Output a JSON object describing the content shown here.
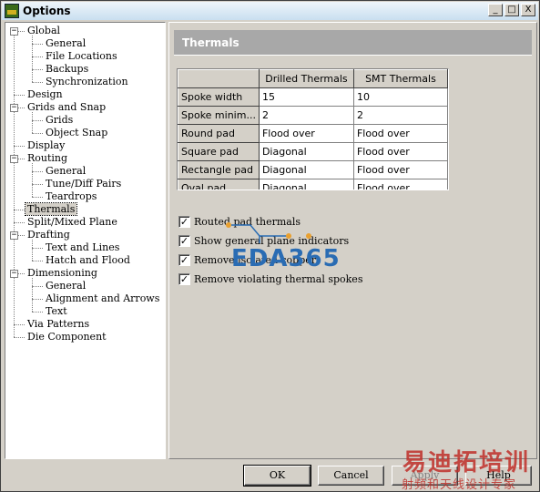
{
  "window": {
    "title": "Options",
    "min_label": "_",
    "max_label": "□",
    "close_label": "X"
  },
  "tree": [
    {
      "label": "Global",
      "level": 0,
      "expander": "−"
    },
    {
      "label": "General",
      "level": 1
    },
    {
      "label": "File Locations",
      "level": 1
    },
    {
      "label": "Backups",
      "level": 1
    },
    {
      "label": "Synchronization",
      "level": 1
    },
    {
      "label": "Design",
      "level": 0
    },
    {
      "label": "Grids and Snap",
      "level": 0,
      "expander": "−"
    },
    {
      "label": "Grids",
      "level": 1
    },
    {
      "label": "Object Snap",
      "level": 1
    },
    {
      "label": "Display",
      "level": 0
    },
    {
      "label": "Routing",
      "level": 0,
      "expander": "−"
    },
    {
      "label": "General",
      "level": 1
    },
    {
      "label": "Tune/Diff Pairs",
      "level": 1
    },
    {
      "label": "Teardrops",
      "level": 1
    },
    {
      "label": "Thermals",
      "level": 0,
      "selected": true
    },
    {
      "label": "Split/Mixed Plane",
      "level": 0
    },
    {
      "label": "Drafting",
      "level": 0,
      "expander": "−"
    },
    {
      "label": "Text and Lines",
      "level": 1
    },
    {
      "label": "Hatch and Flood",
      "level": 1
    },
    {
      "label": "Dimensioning",
      "level": 0,
      "expander": "−"
    },
    {
      "label": "General",
      "level": 1
    },
    {
      "label": "Alignment and Arrows",
      "level": 1
    },
    {
      "label": "Text",
      "level": 1
    },
    {
      "label": "Via Patterns",
      "level": 0
    },
    {
      "label": "Die Component",
      "level": 0
    }
  ],
  "panel": {
    "title": "Thermals",
    "grid": {
      "columns": [
        "",
        "Drilled Thermals",
        "SMT Thermals"
      ],
      "rows": [
        [
          "Spoke width",
          "15",
          "10"
        ],
        [
          "Spoke minim...",
          "2",
          "2"
        ],
        [
          "Round pad",
          "Flood over",
          "Flood over"
        ],
        [
          "Square pad",
          "Diagonal",
          "Flood over"
        ],
        [
          "Rectangle pad",
          "Diagonal",
          "Flood over"
        ],
        [
          "Oval pad",
          "Diagonal",
          "Flood over"
        ]
      ]
    },
    "checkboxes": [
      {
        "label": "Routed pad thermals",
        "checked": true
      },
      {
        "label": "Show general plane indicators",
        "checked": true
      },
      {
        "label": "Remove isolated copper",
        "checked": true
      },
      {
        "label": "Remove violating thermal spokes",
        "checked": true
      }
    ],
    "check_mark": "✓"
  },
  "buttons": {
    "ok": "OK",
    "cancel": "Cancel",
    "apply": "Apply",
    "help": "Help"
  },
  "watermarks": {
    "eda": "EDA365",
    "cn_big": "易迪拓培训",
    "cn_small": "射频和天线设计专家"
  },
  "colors": {
    "title_grad_top": "#eef5fa",
    "face": "#d4d0c8",
    "header_bg": "#a8a8a8",
    "eda_blue": "#2a6cb3",
    "wm_red": "#c0302a"
  }
}
